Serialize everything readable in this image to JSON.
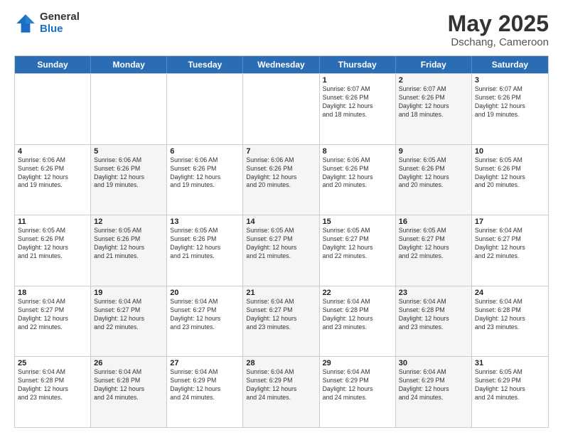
{
  "header": {
    "logo_general": "General",
    "logo_blue": "Blue",
    "title": "May 2025",
    "location": "Dschang, Cameroon"
  },
  "days_of_week": [
    "Sunday",
    "Monday",
    "Tuesday",
    "Wednesday",
    "Thursday",
    "Friday",
    "Saturday"
  ],
  "weeks": [
    [
      {
        "num": "",
        "info": "",
        "empty": true
      },
      {
        "num": "",
        "info": "",
        "empty": true
      },
      {
        "num": "",
        "info": "",
        "empty": true
      },
      {
        "num": "",
        "info": "",
        "empty": true
      },
      {
        "num": "1",
        "info": "Sunrise: 6:07 AM\nSunset: 6:26 PM\nDaylight: 12 hours\nand 18 minutes.",
        "shaded": false
      },
      {
        "num": "2",
        "info": "Sunrise: 6:07 AM\nSunset: 6:26 PM\nDaylight: 12 hours\nand 18 minutes.",
        "shaded": true
      },
      {
        "num": "3",
        "info": "Sunrise: 6:07 AM\nSunset: 6:26 PM\nDaylight: 12 hours\nand 19 minutes.",
        "shaded": false
      }
    ],
    [
      {
        "num": "4",
        "info": "Sunrise: 6:06 AM\nSunset: 6:26 PM\nDaylight: 12 hours\nand 19 minutes.",
        "shaded": false
      },
      {
        "num": "5",
        "info": "Sunrise: 6:06 AM\nSunset: 6:26 PM\nDaylight: 12 hours\nand 19 minutes.",
        "shaded": true
      },
      {
        "num": "6",
        "info": "Sunrise: 6:06 AM\nSunset: 6:26 PM\nDaylight: 12 hours\nand 19 minutes.",
        "shaded": false
      },
      {
        "num": "7",
        "info": "Sunrise: 6:06 AM\nSunset: 6:26 PM\nDaylight: 12 hours\nand 20 minutes.",
        "shaded": true
      },
      {
        "num": "8",
        "info": "Sunrise: 6:06 AM\nSunset: 6:26 PM\nDaylight: 12 hours\nand 20 minutes.",
        "shaded": false
      },
      {
        "num": "9",
        "info": "Sunrise: 6:05 AM\nSunset: 6:26 PM\nDaylight: 12 hours\nand 20 minutes.",
        "shaded": true
      },
      {
        "num": "10",
        "info": "Sunrise: 6:05 AM\nSunset: 6:26 PM\nDaylight: 12 hours\nand 20 minutes.",
        "shaded": false
      }
    ],
    [
      {
        "num": "11",
        "info": "Sunrise: 6:05 AM\nSunset: 6:26 PM\nDaylight: 12 hours\nand 21 minutes.",
        "shaded": false
      },
      {
        "num": "12",
        "info": "Sunrise: 6:05 AM\nSunset: 6:26 PM\nDaylight: 12 hours\nand 21 minutes.",
        "shaded": true
      },
      {
        "num": "13",
        "info": "Sunrise: 6:05 AM\nSunset: 6:26 PM\nDaylight: 12 hours\nand 21 minutes.",
        "shaded": false
      },
      {
        "num": "14",
        "info": "Sunrise: 6:05 AM\nSunset: 6:27 PM\nDaylight: 12 hours\nand 21 minutes.",
        "shaded": true
      },
      {
        "num": "15",
        "info": "Sunrise: 6:05 AM\nSunset: 6:27 PM\nDaylight: 12 hours\nand 22 minutes.",
        "shaded": false
      },
      {
        "num": "16",
        "info": "Sunrise: 6:05 AM\nSunset: 6:27 PM\nDaylight: 12 hours\nand 22 minutes.",
        "shaded": true
      },
      {
        "num": "17",
        "info": "Sunrise: 6:04 AM\nSunset: 6:27 PM\nDaylight: 12 hours\nand 22 minutes.",
        "shaded": false
      }
    ],
    [
      {
        "num": "18",
        "info": "Sunrise: 6:04 AM\nSunset: 6:27 PM\nDaylight: 12 hours\nand 22 minutes.",
        "shaded": false
      },
      {
        "num": "19",
        "info": "Sunrise: 6:04 AM\nSunset: 6:27 PM\nDaylight: 12 hours\nand 22 minutes.",
        "shaded": true
      },
      {
        "num": "20",
        "info": "Sunrise: 6:04 AM\nSunset: 6:27 PM\nDaylight: 12 hours\nand 23 minutes.",
        "shaded": false
      },
      {
        "num": "21",
        "info": "Sunrise: 6:04 AM\nSunset: 6:27 PM\nDaylight: 12 hours\nand 23 minutes.",
        "shaded": true
      },
      {
        "num": "22",
        "info": "Sunrise: 6:04 AM\nSunset: 6:28 PM\nDaylight: 12 hours\nand 23 minutes.",
        "shaded": false
      },
      {
        "num": "23",
        "info": "Sunrise: 6:04 AM\nSunset: 6:28 PM\nDaylight: 12 hours\nand 23 minutes.",
        "shaded": true
      },
      {
        "num": "24",
        "info": "Sunrise: 6:04 AM\nSunset: 6:28 PM\nDaylight: 12 hours\nand 23 minutes.",
        "shaded": false
      }
    ],
    [
      {
        "num": "25",
        "info": "Sunrise: 6:04 AM\nSunset: 6:28 PM\nDaylight: 12 hours\nand 23 minutes.",
        "shaded": false
      },
      {
        "num": "26",
        "info": "Sunrise: 6:04 AM\nSunset: 6:28 PM\nDaylight: 12 hours\nand 24 minutes.",
        "shaded": true
      },
      {
        "num": "27",
        "info": "Sunrise: 6:04 AM\nSunset: 6:29 PM\nDaylight: 12 hours\nand 24 minutes.",
        "shaded": false
      },
      {
        "num": "28",
        "info": "Sunrise: 6:04 AM\nSunset: 6:29 PM\nDaylight: 12 hours\nand 24 minutes.",
        "shaded": true
      },
      {
        "num": "29",
        "info": "Sunrise: 6:04 AM\nSunset: 6:29 PM\nDaylight: 12 hours\nand 24 minutes.",
        "shaded": false
      },
      {
        "num": "30",
        "info": "Sunrise: 6:04 AM\nSunset: 6:29 PM\nDaylight: 12 hours\nand 24 minutes.",
        "shaded": true
      },
      {
        "num": "31",
        "info": "Sunrise: 6:05 AM\nSunset: 6:29 PM\nDaylight: 12 hours\nand 24 minutes.",
        "shaded": false
      }
    ]
  ]
}
